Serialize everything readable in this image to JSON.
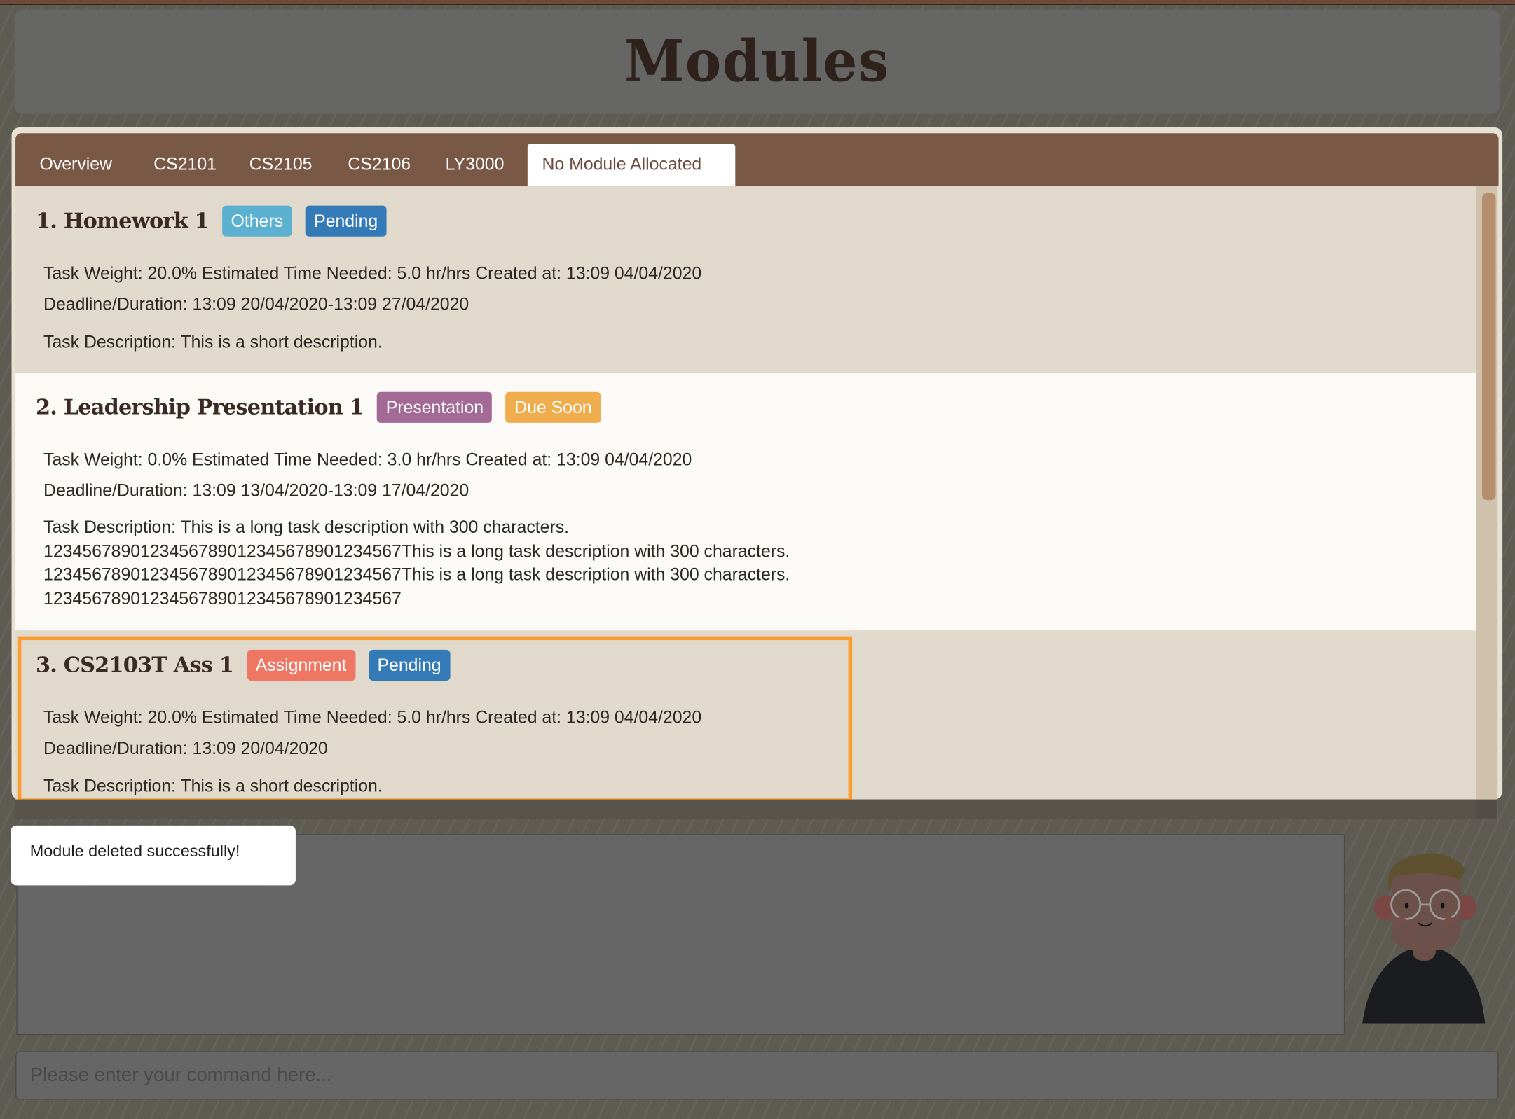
{
  "header": {
    "title": "Modules"
  },
  "tabs": [
    {
      "label": "Overview",
      "active": false
    },
    {
      "label": "CS2101",
      "active": false
    },
    {
      "label": "CS2105",
      "active": false
    },
    {
      "label": "CS2106",
      "active": false
    },
    {
      "label": "LY3000",
      "active": false
    },
    {
      "label": "No Module Allocated",
      "active": true
    }
  ],
  "tasks": [
    {
      "title": "1.  Homework 1",
      "badges": [
        {
          "label": "Others",
          "color": "#5bb1cf"
        },
        {
          "label": "Pending",
          "color": "#337ab7"
        }
      ],
      "info": "Task Weight: 20.0%   Estimated Time Needed: 5.0 hr/hrs   Created at: 13:09 04/04/2020",
      "deadline": "Deadline/Duration: 13:09 20/04/2020-13:09 27/04/2020",
      "description": "Task Description: This is a short description."
    },
    {
      "title": "2.  Leadership Presentation 1",
      "badges": [
        {
          "label": "Presentation",
          "color": "#a26a94"
        },
        {
          "label": "Due Soon",
          "color": "#f0ad4e"
        }
      ],
      "info": "Task Weight: 0.0%   Estimated Time Needed: 3.0 hr/hrs   Created at: 13:09 04/04/2020",
      "deadline": "Deadline/Duration: 13:09 13/04/2020-13:09 17/04/2020",
      "description": "Task Description: This is a long task description with 300 characters.\n1234567890123456789012345678901234567This is a long task description with 300 characters.\n1234567890123456789012345678901234567This is a long task description with 300 characters.\n1234567890123456789012345678901234567"
    },
    {
      "title": "3.  CS2103T Ass 1",
      "badges": [
        {
          "label": "Assignment",
          "color": "#ee7662"
        },
        {
          "label": "Pending",
          "color": "#337ab7"
        }
      ],
      "info": "Task Weight: 20.0%   Estimated Time Needed: 5.0 hr/hrs   Created at: 13:09 04/04/2020",
      "deadline": "Deadline/Duration: 13:09 20/04/2020",
      "description": "Task Description: This is a short description."
    }
  ],
  "result": {
    "message": "Module deleted successfully!"
  },
  "command": {
    "placeholder": "Please enter your command here...",
    "value": ""
  },
  "colors": {
    "selection": "#fb9e2d",
    "tabbar": "#7a5846",
    "scroll_thumb": "#b48e6d"
  }
}
